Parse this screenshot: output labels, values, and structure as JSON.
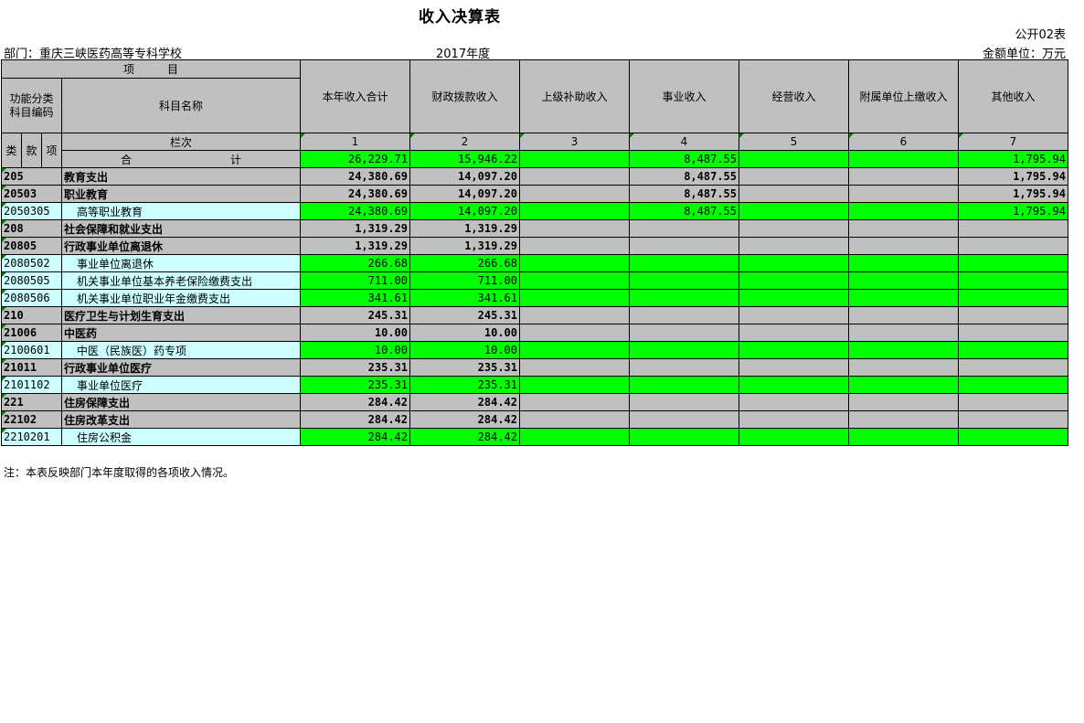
{
  "title": "收入决算表",
  "form_code": "公开02表",
  "department": "部门：重庆三峡医药高等专科学校",
  "year": "2017年度",
  "unit": "金额单位：万元",
  "note": "注：本表反映部门本年度取得的各项收入情况。",
  "header": {
    "item": "项　　　目",
    "func_code": "功能分类\n科目编码",
    "subject_name": "科目名称",
    "lei": "类",
    "kuan": "款",
    "xiang": "项",
    "lanci": "栏次",
    "columns": [
      "本年收入合计",
      "财政拨款收入",
      "上级补助收入",
      "事业收入",
      "经营收入",
      "附属单位上缴收入",
      "其他收入"
    ],
    "column_numbers": [
      "1",
      "2",
      "3",
      "4",
      "5",
      "6",
      "7"
    ]
  },
  "total": {
    "label": "合　　　　　　　　　计",
    "values": [
      "26,229.71",
      "15,946.22",
      "",
      "8,487.55",
      "",
      "",
      "1,795.94"
    ]
  },
  "rows": [
    {
      "code": "205",
      "name": "教育支出",
      "level": "class",
      "values": [
        "24,380.69",
        "14,097.20",
        "",
        "8,487.55",
        "",
        "",
        "1,795.94"
      ]
    },
    {
      "code": "20503",
      "name": "职业教育",
      "level": "class",
      "values": [
        "24,380.69",
        "14,097.20",
        "",
        "8,487.55",
        "",
        "",
        "1,795.94"
      ]
    },
    {
      "code": "2050305",
      "name": "高等职业教育",
      "level": "item",
      "values": [
        "24,380.69",
        "14,097.20",
        "",
        "8,487.55",
        "",
        "",
        "1,795.94"
      ]
    },
    {
      "code": "208",
      "name": "社会保障和就业支出",
      "level": "class",
      "values": [
        "1,319.29",
        "1,319.29",
        "",
        "",
        "",
        "",
        ""
      ]
    },
    {
      "code": "20805",
      "name": "行政事业单位离退休",
      "level": "class",
      "values": [
        "1,319.29",
        "1,319.29",
        "",
        "",
        "",
        "",
        ""
      ]
    },
    {
      "code": "2080502",
      "name": "事业单位离退休",
      "level": "item",
      "values": [
        "266.68",
        "266.68",
        "",
        "",
        "",
        "",
        ""
      ]
    },
    {
      "code": "2080505",
      "name": "机关事业单位基本养老保险缴费支出",
      "level": "item",
      "values": [
        "711.00",
        "711.00",
        "",
        "",
        "",
        "",
        ""
      ]
    },
    {
      "code": "2080506",
      "name": "机关事业单位职业年金缴费支出",
      "level": "item",
      "values": [
        "341.61",
        "341.61",
        "",
        "",
        "",
        "",
        ""
      ]
    },
    {
      "code": "210",
      "name": "医疗卫生与计划生育支出",
      "level": "class",
      "values": [
        "245.31",
        "245.31",
        "",
        "",
        "",
        "",
        ""
      ]
    },
    {
      "code": "21006",
      "name": "中医药",
      "level": "class",
      "values": [
        "10.00",
        "10.00",
        "",
        "",
        "",
        "",
        ""
      ]
    },
    {
      "code": "2100601",
      "name": "中医（民族医）药专项",
      "level": "item",
      "values": [
        "10.00",
        "10.00",
        "",
        "",
        "",
        "",
        ""
      ]
    },
    {
      "code": "21011",
      "name": "行政事业单位医疗",
      "level": "class",
      "values": [
        "235.31",
        "235.31",
        "",
        "",
        "",
        "",
        ""
      ]
    },
    {
      "code": "2101102",
      "name": "事业单位医疗",
      "level": "item",
      "values": [
        "235.31",
        "235.31",
        "",
        "",
        "",
        "",
        ""
      ]
    },
    {
      "code": "221",
      "name": "住房保障支出",
      "level": "class",
      "values": [
        "284.42",
        "284.42",
        "",
        "",
        "",
        "",
        ""
      ]
    },
    {
      "code": "22102",
      "name": "住房改革支出",
      "level": "class",
      "values": [
        "284.42",
        "284.42",
        "",
        "",
        "",
        "",
        ""
      ]
    },
    {
      "code": "2210201",
      "name": "住房公积金",
      "level": "item",
      "values": [
        "284.42",
        "284.42",
        "",
        "",
        "",
        "",
        ""
      ]
    }
  ]
}
